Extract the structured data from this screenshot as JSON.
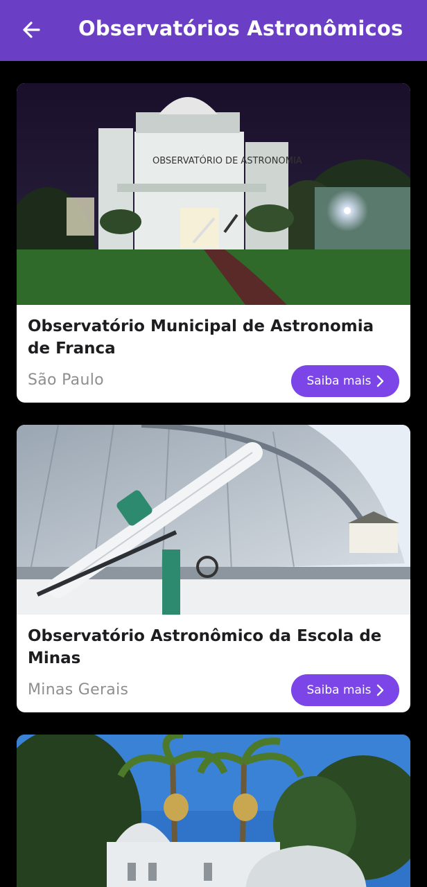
{
  "app_bar": {
    "title": "Observatórios Astronômicos",
    "back_icon": "arrow-left-icon",
    "background": "#6a3fc6"
  },
  "observatories": [
    {
      "name": "Observatório Municipal de Astronomia de Franca",
      "state": "São Paulo",
      "button_label": "Saiba mais",
      "photo_sign": "OBSERVATÓRIO DE ASTRONOMIA"
    },
    {
      "name": "Observatório Astronômico da Escola de Minas",
      "state": "Minas Gerais",
      "button_label": "Saiba mais"
    },
    {
      "name": "",
      "state": ""
    }
  ],
  "colors": {
    "accent_button": "#7b45e8",
    "card_bg": "#ffffff",
    "page_bg": "#000000"
  }
}
